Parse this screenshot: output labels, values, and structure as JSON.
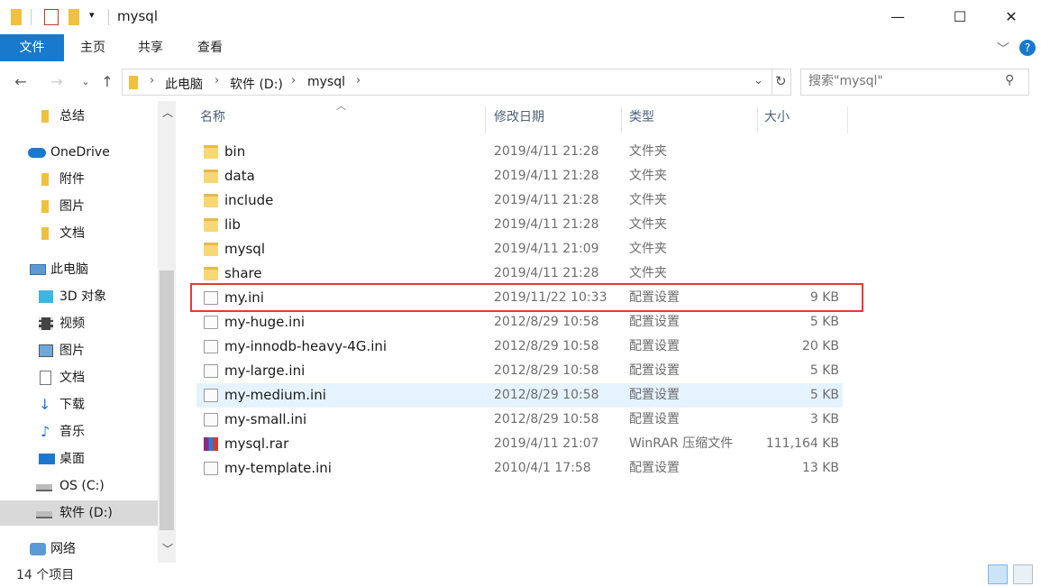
{
  "window": {
    "title": "mysql",
    "minimize": "—",
    "maximize": "☐",
    "close": "✕"
  },
  "ribbon": {
    "tabs": [
      "文件",
      "主页",
      "共享",
      "查看"
    ]
  },
  "address": {
    "crumbs": [
      "此电脑",
      "软件 (D:)",
      "mysql"
    ],
    "search_placeholder": "搜索\"mysql\""
  },
  "sidebar": {
    "items": [
      {
        "label": "总结",
        "icon": "folder-icon"
      },
      {
        "label": "OneDrive",
        "icon": "cloud-icon"
      },
      {
        "label": "附件",
        "icon": "folder-icon"
      },
      {
        "label": "图片",
        "icon": "folder-icon"
      },
      {
        "label": "文档",
        "icon": "folder-icon"
      },
      {
        "label": "此电脑",
        "icon": "computer-icon"
      },
      {
        "label": "3D 对象",
        "icon": "cube-icon"
      },
      {
        "label": "视频",
        "icon": "video-icon"
      },
      {
        "label": "图片",
        "icon": "pictures-icon"
      },
      {
        "label": "文档",
        "icon": "documents-icon"
      },
      {
        "label": "下载",
        "icon": "download-icon"
      },
      {
        "label": "音乐",
        "icon": "music-icon"
      },
      {
        "label": "桌面",
        "icon": "desktop-icon"
      },
      {
        "label": "OS (C:)",
        "icon": "drive-c-icon"
      },
      {
        "label": "软件 (D:)",
        "icon": "drive-d-icon"
      },
      {
        "label": "网络",
        "icon": "network-icon"
      }
    ]
  },
  "columns": {
    "name": "名称",
    "date": "修改日期",
    "type": "类型",
    "size": "大小"
  },
  "files": [
    {
      "name": "bin",
      "date": "2019/4/11 21:28",
      "type": "文件夹",
      "size": "",
      "kind": "folder"
    },
    {
      "name": "data",
      "date": "2019/4/11 21:28",
      "type": "文件夹",
      "size": "",
      "kind": "folder"
    },
    {
      "name": "include",
      "date": "2019/4/11 21:28",
      "type": "文件夹",
      "size": "",
      "kind": "folder"
    },
    {
      "name": "lib",
      "date": "2019/4/11 21:28",
      "type": "文件夹",
      "size": "",
      "kind": "folder"
    },
    {
      "name": "mysql",
      "date": "2019/4/11 21:09",
      "type": "文件夹",
      "size": "",
      "kind": "folder"
    },
    {
      "name": "share",
      "date": "2019/4/11 21:28",
      "type": "文件夹",
      "size": "",
      "kind": "folder"
    },
    {
      "name": "my.ini",
      "date": "2019/11/22 10:33",
      "type": "配置设置",
      "size": "9 KB",
      "kind": "ini"
    },
    {
      "name": "my-huge.ini",
      "date": "2012/8/29 10:58",
      "type": "配置设置",
      "size": "5 KB",
      "kind": "ini"
    },
    {
      "name": "my-innodb-heavy-4G.ini",
      "date": "2012/8/29 10:58",
      "type": "配置设置",
      "size": "20 KB",
      "kind": "ini"
    },
    {
      "name": "my-large.ini",
      "date": "2012/8/29 10:58",
      "type": "配置设置",
      "size": "5 KB",
      "kind": "ini"
    },
    {
      "name": "my-medium.ini",
      "date": "2012/8/29 10:58",
      "type": "配置设置",
      "size": "5 KB",
      "kind": "ini"
    },
    {
      "name": "my-small.ini",
      "date": "2012/8/29 10:58",
      "type": "配置设置",
      "size": "3 KB",
      "kind": "ini"
    },
    {
      "name": "mysql.rar",
      "date": "2019/4/11 21:07",
      "type": "WinRAR 压缩文件",
      "size": "111,164 KB",
      "kind": "rar"
    },
    {
      "name": "my-template.ini",
      "date": "2010/4/1 17:58",
      "type": "配置设置",
      "size": "13 KB",
      "kind": "ini"
    }
  ],
  "status": {
    "count_text": "14 个项目"
  },
  "colors": {
    "accent": "#1979ca",
    "highlight": "#e53935",
    "hover": "#e5f3ff"
  }
}
